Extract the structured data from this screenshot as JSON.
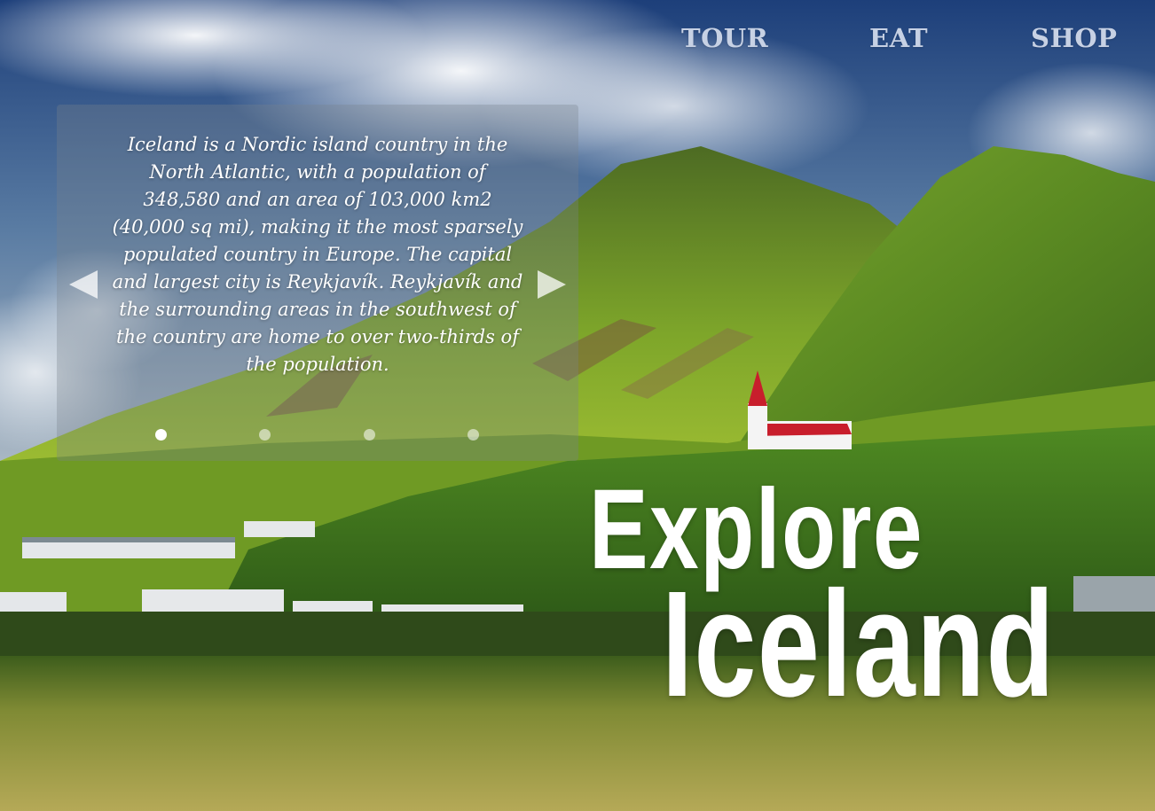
{
  "nav": {
    "items": [
      {
        "label": "TOUR"
      },
      {
        "label": "EAT"
      },
      {
        "label": "SHOP"
      }
    ]
  },
  "carousel": {
    "text": "Iceland is a Nordic island country in the North Atlantic, with a population of 348,580 and an area of 103,000 km2 (40,000 sq mi), making it the most sparsely populated country in Europe. The capital and largest city is Reykjavík. Reykjavík and the surrounding areas in the southwest of the country are home to over two-thirds of the population.",
    "slide_count": 4,
    "active_slide": 1,
    "prev_icon": "triangle-left-icon",
    "next_icon": "triangle-right-icon"
  },
  "headline": {
    "line1": "Explore",
    "line2": "Iceland"
  },
  "colors": {
    "nav_text": "#c7d1e4",
    "headline": "#ffffff",
    "panel": "rgba(120,130,140,0.32)"
  }
}
